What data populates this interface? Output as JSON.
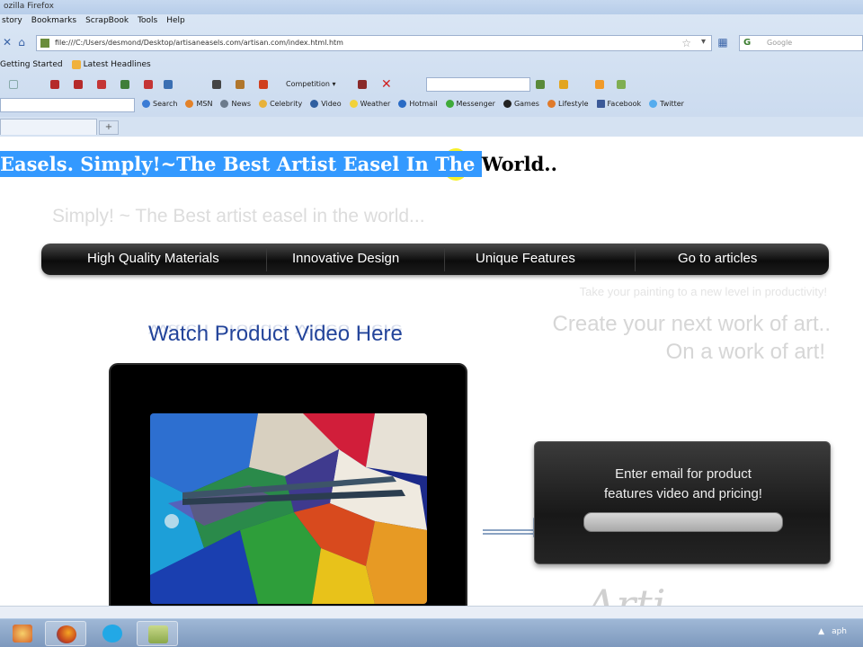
{
  "browser": {
    "window_title": "ozilla Firefox",
    "menu": [
      "story",
      "Bookmarks",
      "ScrapBook",
      "Tools",
      "Help"
    ],
    "url": "file:///C:/Users/desmond/Desktop/artisaneasels.com/artisan.com/index.html.htm",
    "search_placeholder": "Google",
    "bookmarks": [
      "Getting Started",
      "Latest Headlines"
    ],
    "toolbar_label": "Competition",
    "toolbar3_items": [
      "Search",
      "MSN",
      "News",
      "Celebrity",
      "Video",
      "Weather",
      "Hotmail",
      "Messenger",
      "Games",
      "Lifestyle",
      "Facebook",
      "Twitter"
    ],
    "newtab_symbol": "+"
  },
  "page": {
    "heading_selected": "Easels. Simply!~The Best Artist Easel In The ",
    "heading_rest": "World..",
    "tagline": "Simply! ~ The Best artist easel in the world...",
    "nav": [
      "High Quality Materials",
      "Innovative Design",
      "Unique Features",
      "Go to articles"
    ],
    "sub_tagline": "Take your painting to a new level in productivity!",
    "promo_line1": "Create your next work of art..",
    "promo_line2": "On a work of art!",
    "video_heading": "Watch Product Video Here",
    "signup_line1": "Enter email for  product",
    "signup_line2": "features video and pricing!",
    "script_text": "Arti"
  },
  "taskbar": {
    "tray_text": "aph"
  },
  "colors": {
    "selection": "#3399ff",
    "link_blue": "#23449a",
    "navbar_dark": "#0c0c0c",
    "cursor_highlight": "#f6ee14"
  }
}
